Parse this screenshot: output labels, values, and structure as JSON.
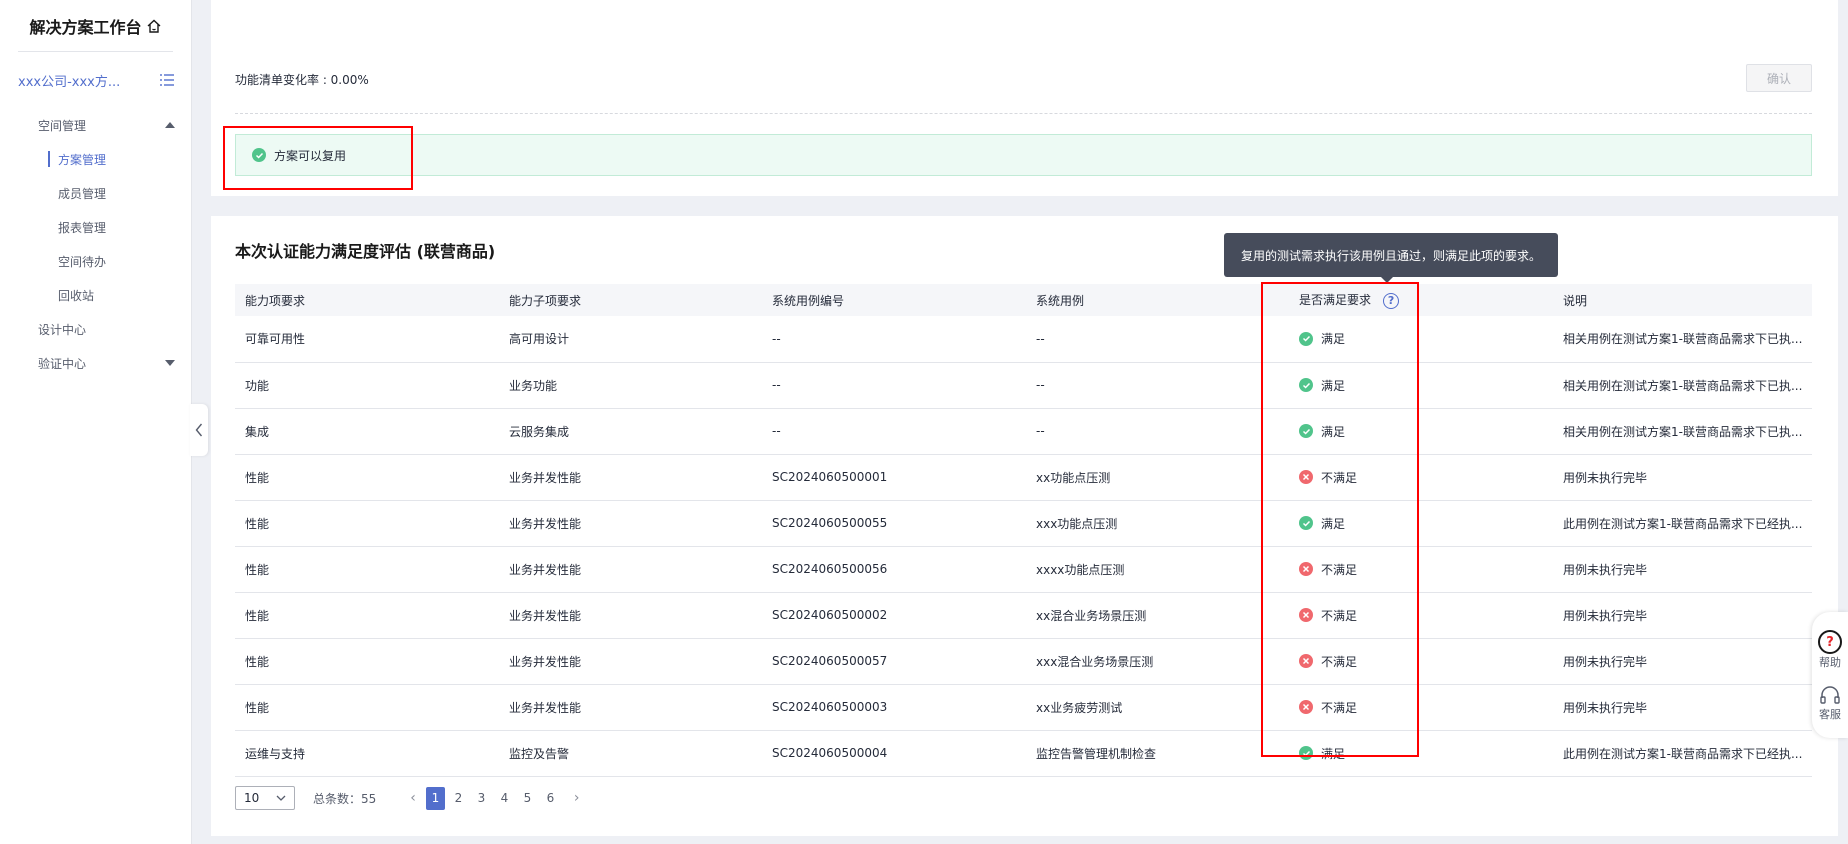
{
  "sidebar": {
    "title": "解决方案工作台",
    "project": "xxx公司-xxx方...",
    "groups": [
      {
        "label": "空间管理",
        "expanded": true,
        "items": [
          "方案管理",
          "成员管理",
          "报表管理",
          "空间待办",
          "回收站"
        ]
      },
      {
        "label": "设计中心"
      },
      {
        "label": "验证中心",
        "expanded": false
      }
    ],
    "active_item": "方案管理"
  },
  "top_card": {
    "change_rate": "功能清单变化率 : 0.00%",
    "confirm_label": "确认",
    "success_text": "方案可以复用"
  },
  "eval": {
    "title": "本次认证能力满足度评估 (联营商品)",
    "tooltip": "复用的测试需求执行该用例且通过，则满足此项的要求。",
    "columns": [
      "能力项要求",
      "能力子项要求",
      "系统用例编号",
      "系统用例",
      "是否满足要求",
      "说明"
    ],
    "rows": [
      {
        "c1": "可靠可用性",
        "c2": "高可用设计",
        "c3": "--",
        "c4": "--",
        "ok": true,
        "status": "满足",
        "note": "相关用例在测试方案1-联营商品需求下已执..."
      },
      {
        "c1": "功能",
        "c2": "业务功能",
        "c3": "--",
        "c4": "--",
        "ok": true,
        "status": "满足",
        "note": "相关用例在测试方案1-联营商品需求下已执..."
      },
      {
        "c1": "集成",
        "c2": "云服务集成",
        "c3": "--",
        "c4": "--",
        "ok": true,
        "status": "满足",
        "note": "相关用例在测试方案1-联营商品需求下已执..."
      },
      {
        "c1": "性能",
        "c2": "业务并发性能",
        "c3": "SC2024060500001",
        "c4": "xx功能点压测",
        "ok": false,
        "status": "不满足",
        "note": "用例未执行完毕"
      },
      {
        "c1": "性能",
        "c2": "业务并发性能",
        "c3": "SC2024060500055",
        "c4": "xxx功能点压测",
        "ok": true,
        "status": "满足",
        "note": "此用例在测试方案1-联营商品需求下已经执..."
      },
      {
        "c1": "性能",
        "c2": "业务并发性能",
        "c3": "SC2024060500056",
        "c4": "xxxx功能点压测",
        "ok": false,
        "status": "不满足",
        "note": "用例未执行完毕"
      },
      {
        "c1": "性能",
        "c2": "业务并发性能",
        "c3": "SC2024060500002",
        "c4": "xx混合业务场景压测",
        "ok": false,
        "status": "不满足",
        "note": "用例未执行完毕"
      },
      {
        "c1": "性能",
        "c2": "业务并发性能",
        "c3": "SC2024060500057",
        "c4": "xxx混合业务场景压测",
        "ok": false,
        "status": "不满足",
        "note": "用例未执行完毕"
      },
      {
        "c1": "性能",
        "c2": "业务并发性能",
        "c3": "SC2024060500003",
        "c4": "xx业务疲劳测试",
        "ok": false,
        "status": "不满足",
        "note": "用例未执行完毕"
      },
      {
        "c1": "运维与支持",
        "c2": "监控及告警",
        "c3": "SC2024060500004",
        "c4": "监控告警管理机制检查",
        "ok": true,
        "status": "满足",
        "note": "此用例在测试方案1-联营商品需求下已经执..."
      }
    ],
    "pagination": {
      "page_size": "10",
      "total": "总条数：55",
      "pages": [
        "1",
        "2",
        "3",
        "4",
        "5",
        "6"
      ],
      "current": "1"
    }
  },
  "float_panel": {
    "help_label": "帮助",
    "service_label": "客服"
  },
  "colors": {
    "accent": "#526ecc",
    "success": "#50c48b",
    "error": "#f0686d",
    "highlight": "#ff0000"
  }
}
